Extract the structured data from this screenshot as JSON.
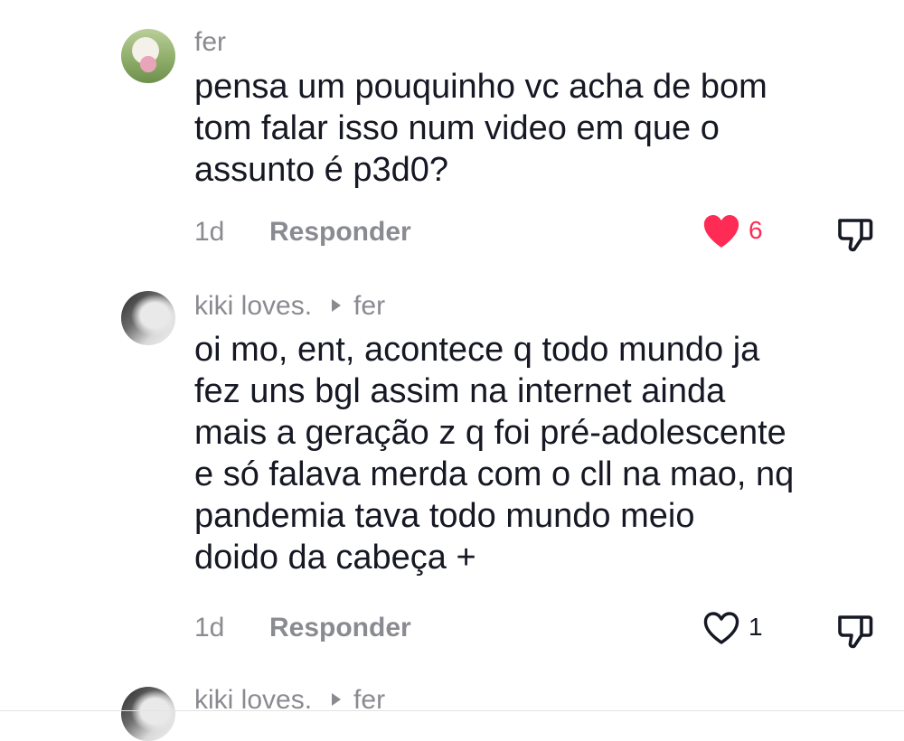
{
  "comments": [
    {
      "username": "fer",
      "reply_to": "",
      "text": "pensa um pouquinho vc acha de bom\ntom falar isso num video em que o\nassunto é p3d0?",
      "time": "1d",
      "reply_label": "Responder",
      "likes": "6",
      "liked": true
    },
    {
      "username": "kiki loves.",
      "reply_to": "fer",
      "text": "oi mo, ent, acontece q todo mundo ja\nfez uns bgl assim na internet ainda\nmais a geração z q foi pré-adolescente\ne só falava merda com o cll na mao, nq\npandemia tava todo mundo meio\ndoido da cabeça +",
      "time": "1d",
      "reply_label": "Responder",
      "likes": "1",
      "liked": false
    },
    {
      "username": "kiki loves.",
      "reply_to": "fer"
    }
  ],
  "colors": {
    "text_primary": "#161823",
    "text_secondary": "#8a8b91",
    "like_active": "#fe2c55"
  },
  "icons": {
    "like": "heart-icon",
    "dislike": "thumbs-down-icon",
    "reply_arrow": "reply-arrow-icon"
  }
}
